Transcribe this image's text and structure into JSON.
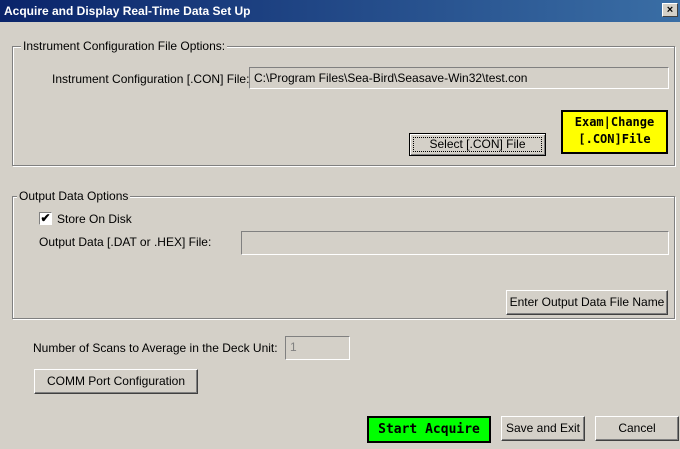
{
  "window": {
    "title": "Acquire and Display Real-Time Data Set Up",
    "close_label": "×"
  },
  "instrument_group": {
    "legend": "Instrument Configuration File Options:",
    "con_file_label": "Instrument Configuration [.CON] File:",
    "con_file_value": "C:\\Program Files\\Sea-Bird\\Seasave-Win32\\test.con",
    "select_button": "Select [.CON] File",
    "exam_button_line1": "Exam|Change",
    "exam_button_line2": "[.CON]File"
  },
  "output_group": {
    "legend": "Output Data Options",
    "store_on_disk_label": "Store On Disk",
    "store_on_disk_checked": true,
    "check_mark": "✔",
    "output_file_label": "Output Data [.DAT or .HEX] File:",
    "output_file_value": "",
    "enter_button": "Enter Output Data File Name"
  },
  "scans": {
    "label": "Number of Scans to Average in the Deck Unit:",
    "value": "1"
  },
  "buttons": {
    "comm_port": "COMM Port Configuration",
    "start_acquire": "Start Acquire",
    "save_exit": "Save and Exit",
    "cancel": "Cancel"
  },
  "colors": {
    "dialog_bg": "#d4d0c8",
    "title_bar": "#0a246a",
    "exam_button_bg": "#ffff00",
    "start_button_bg": "#00ff00"
  }
}
